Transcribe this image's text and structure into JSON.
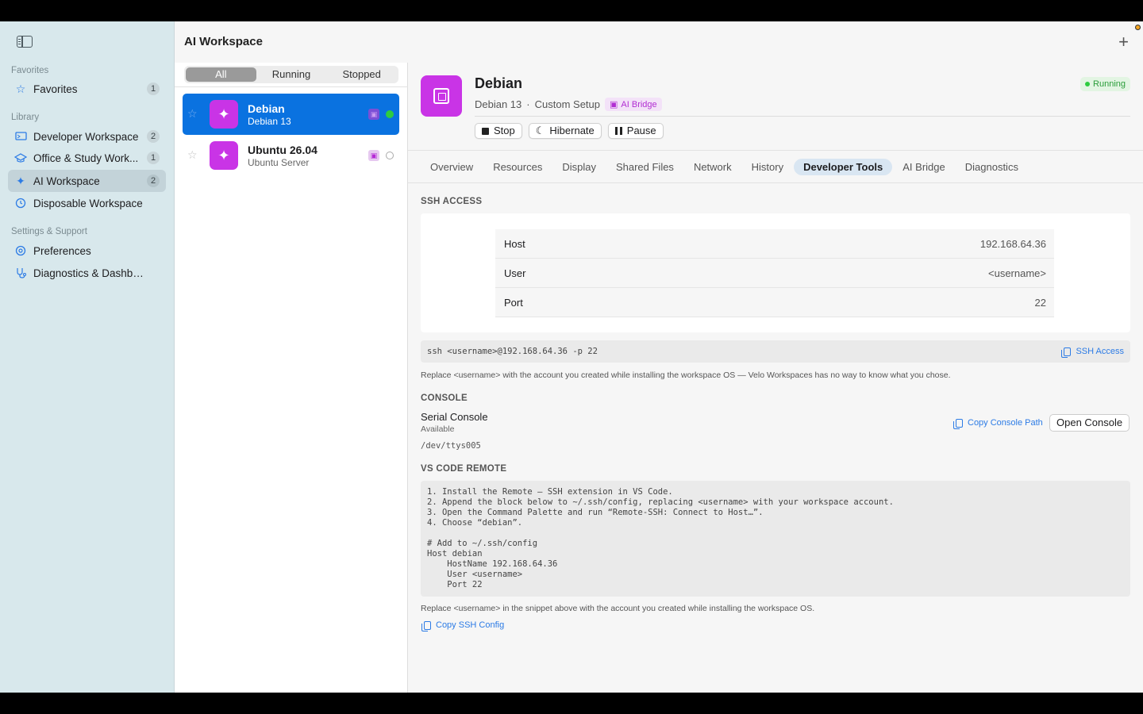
{
  "header": {
    "title": "AI Workspace"
  },
  "sidebar": {
    "sections": [
      {
        "label": "Favorites"
      },
      {
        "label": "Library"
      },
      {
        "label": "Settings & Support"
      }
    ],
    "items": [
      {
        "label": "Favorites",
        "count": "1",
        "icon": "star-icon"
      },
      {
        "label": "Developer Workspace",
        "count": "2",
        "icon": "monitor-icon"
      },
      {
        "label": "Office & Study Work...",
        "count": "1",
        "icon": "graduation-cap-icon"
      },
      {
        "label": "AI Workspace",
        "count": "2",
        "icon": "sparkle-icon"
      },
      {
        "label": "Disposable Workspace",
        "icon": "timer-icon"
      },
      {
        "label": "Preferences",
        "icon": "gear-icon"
      },
      {
        "label": "Diagnostics & Dashboard",
        "icon": "stethoscope-icon"
      }
    ]
  },
  "filter": {
    "options": [
      "All",
      "Running",
      "Stopped"
    ],
    "selected": "All"
  },
  "vms": [
    {
      "name": "Debian",
      "sub": "Debian 13",
      "status": "running"
    },
    {
      "name": "Ubuntu 26.04",
      "sub": "Ubuntu Server",
      "status": "stopped"
    }
  ],
  "detail": {
    "name": "Debian",
    "os": "Debian 13",
    "separator": "·",
    "setup": "Custom Setup",
    "badge": "AI Bridge",
    "status": "Running",
    "actions": {
      "stop": "Stop",
      "hibernate": "Hibernate",
      "pause": "Pause"
    },
    "tabs": [
      "Overview",
      "Resources",
      "Display",
      "Shared Files",
      "Network",
      "History",
      "Developer Tools",
      "AI Bridge",
      "Diagnostics"
    ],
    "active_tab": "Developer Tools",
    "ssh": {
      "heading": "SSH ACCESS",
      "rows": [
        {
          "key": "Host",
          "value": "192.168.64.36"
        },
        {
          "key": "User",
          "value": "<username>"
        },
        {
          "key": "Port",
          "value": "22"
        }
      ],
      "command": "ssh <username>@192.168.64.36 -p 22",
      "copy_label": "SSH Access",
      "note": "Replace <username> with the account you created while installing the workspace OS — Velo Workspaces has no way to know what you chose."
    },
    "console": {
      "heading": "CONSOLE",
      "title": "Serial Console",
      "status": "Available",
      "path": "/dev/ttys005",
      "copy_label": "Copy Console Path",
      "open_label": "Open Console"
    },
    "vscode": {
      "heading": "VS CODE REMOTE",
      "snippet": "1. Install the Remote – SSH extension in VS Code.\n2. Append the block below to ~/.ssh/config, replacing <username> with your workspace account.\n3. Open the Command Palette and run “Remote-SSH: Connect to Host…”.\n4. Choose “debian”.\n\n# Add to ~/.ssh/config\nHost debian\n    HostName 192.168.64.36\n    User <username>\n    Port 22",
      "note": "Replace <username> in the snippet above with the account you created while installing the workspace OS.",
      "copy_label": "Copy SSH Config"
    }
  }
}
